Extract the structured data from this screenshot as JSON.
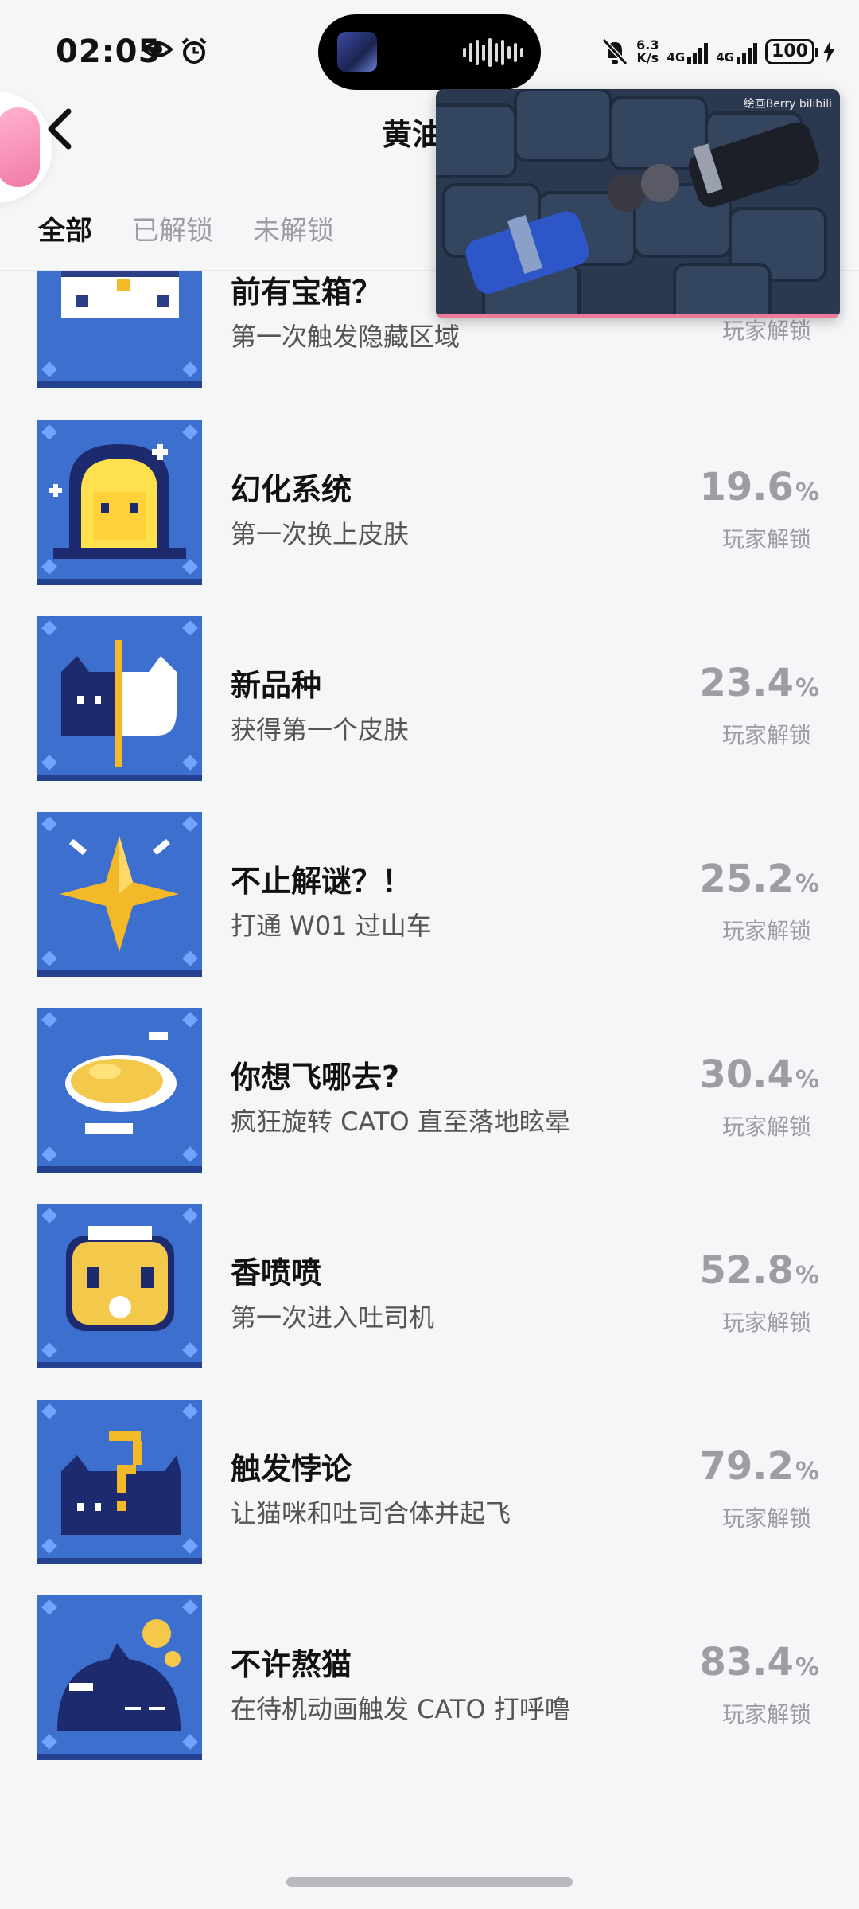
{
  "status_bar": {
    "time": "02:05",
    "net_speed_top": "6.3",
    "net_speed_bottom": "K/s",
    "sim1_label": "4G",
    "sim2_label": "4G",
    "battery": "100"
  },
  "header": {
    "title": "黄油",
    "tabs": [
      {
        "label": "全部",
        "active": true
      },
      {
        "label": "已解锁",
        "active": false
      },
      {
        "label": "未解锁",
        "active": false
      }
    ]
  },
  "pip": {
    "watermark": "绘画Berry bilibili"
  },
  "achievements": [
    {
      "title": "前有宝箱？",
      "desc": "第一次触发隐藏区域",
      "percent": "",
      "unit": "",
      "sub": "玩家解锁",
      "icon": "treasure-chest-icon"
    },
    {
      "title": "幻化系统",
      "desc": "第一次换上皮肤",
      "percent": "19.6",
      "unit": "%",
      "sub": "玩家解锁",
      "icon": "cat-portal-icon"
    },
    {
      "title": "新品种",
      "desc": "获得第一个皮肤",
      "percent": "23.4",
      "unit": "%",
      "sub": "玩家解锁",
      "icon": "half-cat-icon"
    },
    {
      "title": "不止解谜？！",
      "desc": "打通 W01 过山车",
      "percent": "25.2",
      "unit": "%",
      "sub": "玩家解锁",
      "icon": "sparkle-star-icon"
    },
    {
      "title": "你想飞哪去?",
      "desc": "疯狂旋转 CATO 直至落地眩晕",
      "percent": "30.4",
      "unit": "%",
      "sub": "玩家解锁",
      "icon": "dizzy-cloud-icon"
    },
    {
      "title": "香喷喷",
      "desc": "第一次进入吐司机",
      "percent": "52.8",
      "unit": "%",
      "sub": "玩家解锁",
      "icon": "toast-icon"
    },
    {
      "title": "触发悖论",
      "desc": "让猫咪和吐司合体并起飞",
      "percent": "79.2",
      "unit": "%",
      "sub": "玩家解锁",
      "icon": "question-cat-icon"
    },
    {
      "title": "不许熬猫",
      "desc": "在待机动画触发 CATO 打呼噜",
      "percent": "83.4",
      "unit": "%",
      "sub": "玩家解锁",
      "icon": "sleeping-cat-icon"
    }
  ]
}
